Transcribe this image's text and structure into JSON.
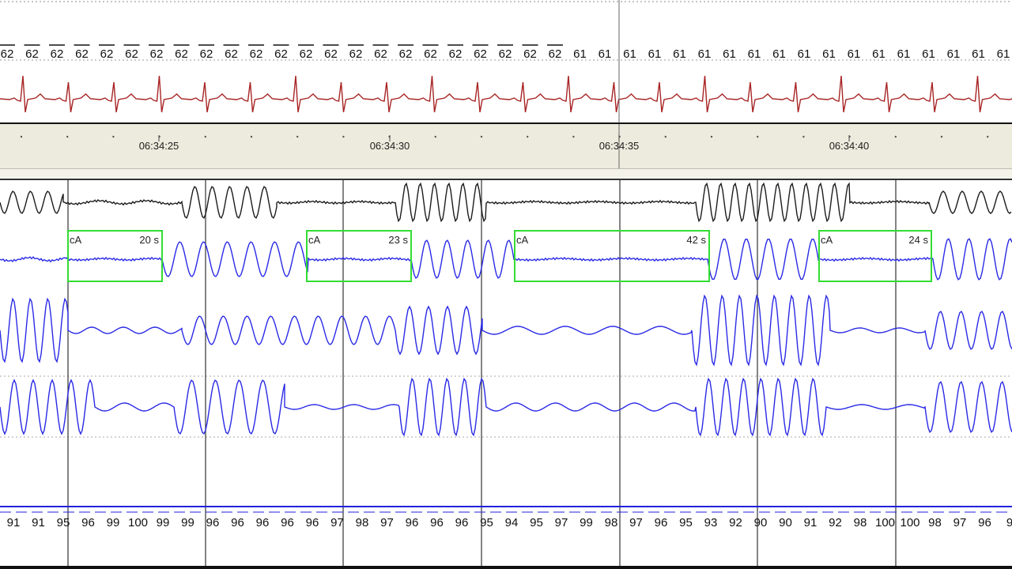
{
  "heart_rate": {
    "values": [
      "62",
      "62",
      "62",
      "62",
      "62",
      "62",
      "62",
      "62",
      "62",
      "62",
      "62",
      "62",
      "62",
      "62",
      "62",
      "62",
      "62",
      "62",
      "62",
      "62",
      "62",
      "62",
      "62",
      "61",
      "61",
      "61",
      "61",
      "61",
      "61",
      "61",
      "61",
      "61",
      "61",
      "61",
      "61",
      "61",
      "61",
      "61",
      "61",
      "61",
      "61"
    ]
  },
  "time_ruler": {
    "labels": [
      "06:34:25",
      "06:34:30",
      "06:34:35",
      "06:34:40"
    ]
  },
  "events": [
    {
      "type": "cA",
      "duration": "20 s"
    },
    {
      "type": "cA",
      "duration": "23 s"
    },
    {
      "type": "cA",
      "duration": "42 s"
    },
    {
      "type": "cA",
      "duration": "24 s"
    }
  ],
  "spo2": {
    "values": [
      "91",
      "91",
      "95",
      "96",
      "99",
      "100",
      "99",
      "99",
      "96",
      "96",
      "96",
      "96",
      "96",
      "97",
      "98",
      "97",
      "96",
      "96",
      "96",
      "95",
      "94",
      "95",
      "97",
      "99",
      "98",
      "97",
      "96",
      "95",
      "93",
      "92",
      "90",
      "90",
      "91",
      "92",
      "98",
      "100",
      "100",
      "98",
      "97",
      "96",
      "9"
    ]
  },
  "colors": {
    "ecg": "#a82424",
    "flow": "#1c1c1c",
    "effort": "#2a2ae6",
    "event_box": "#33dd33",
    "spo2_line": "#2222dd"
  }
}
